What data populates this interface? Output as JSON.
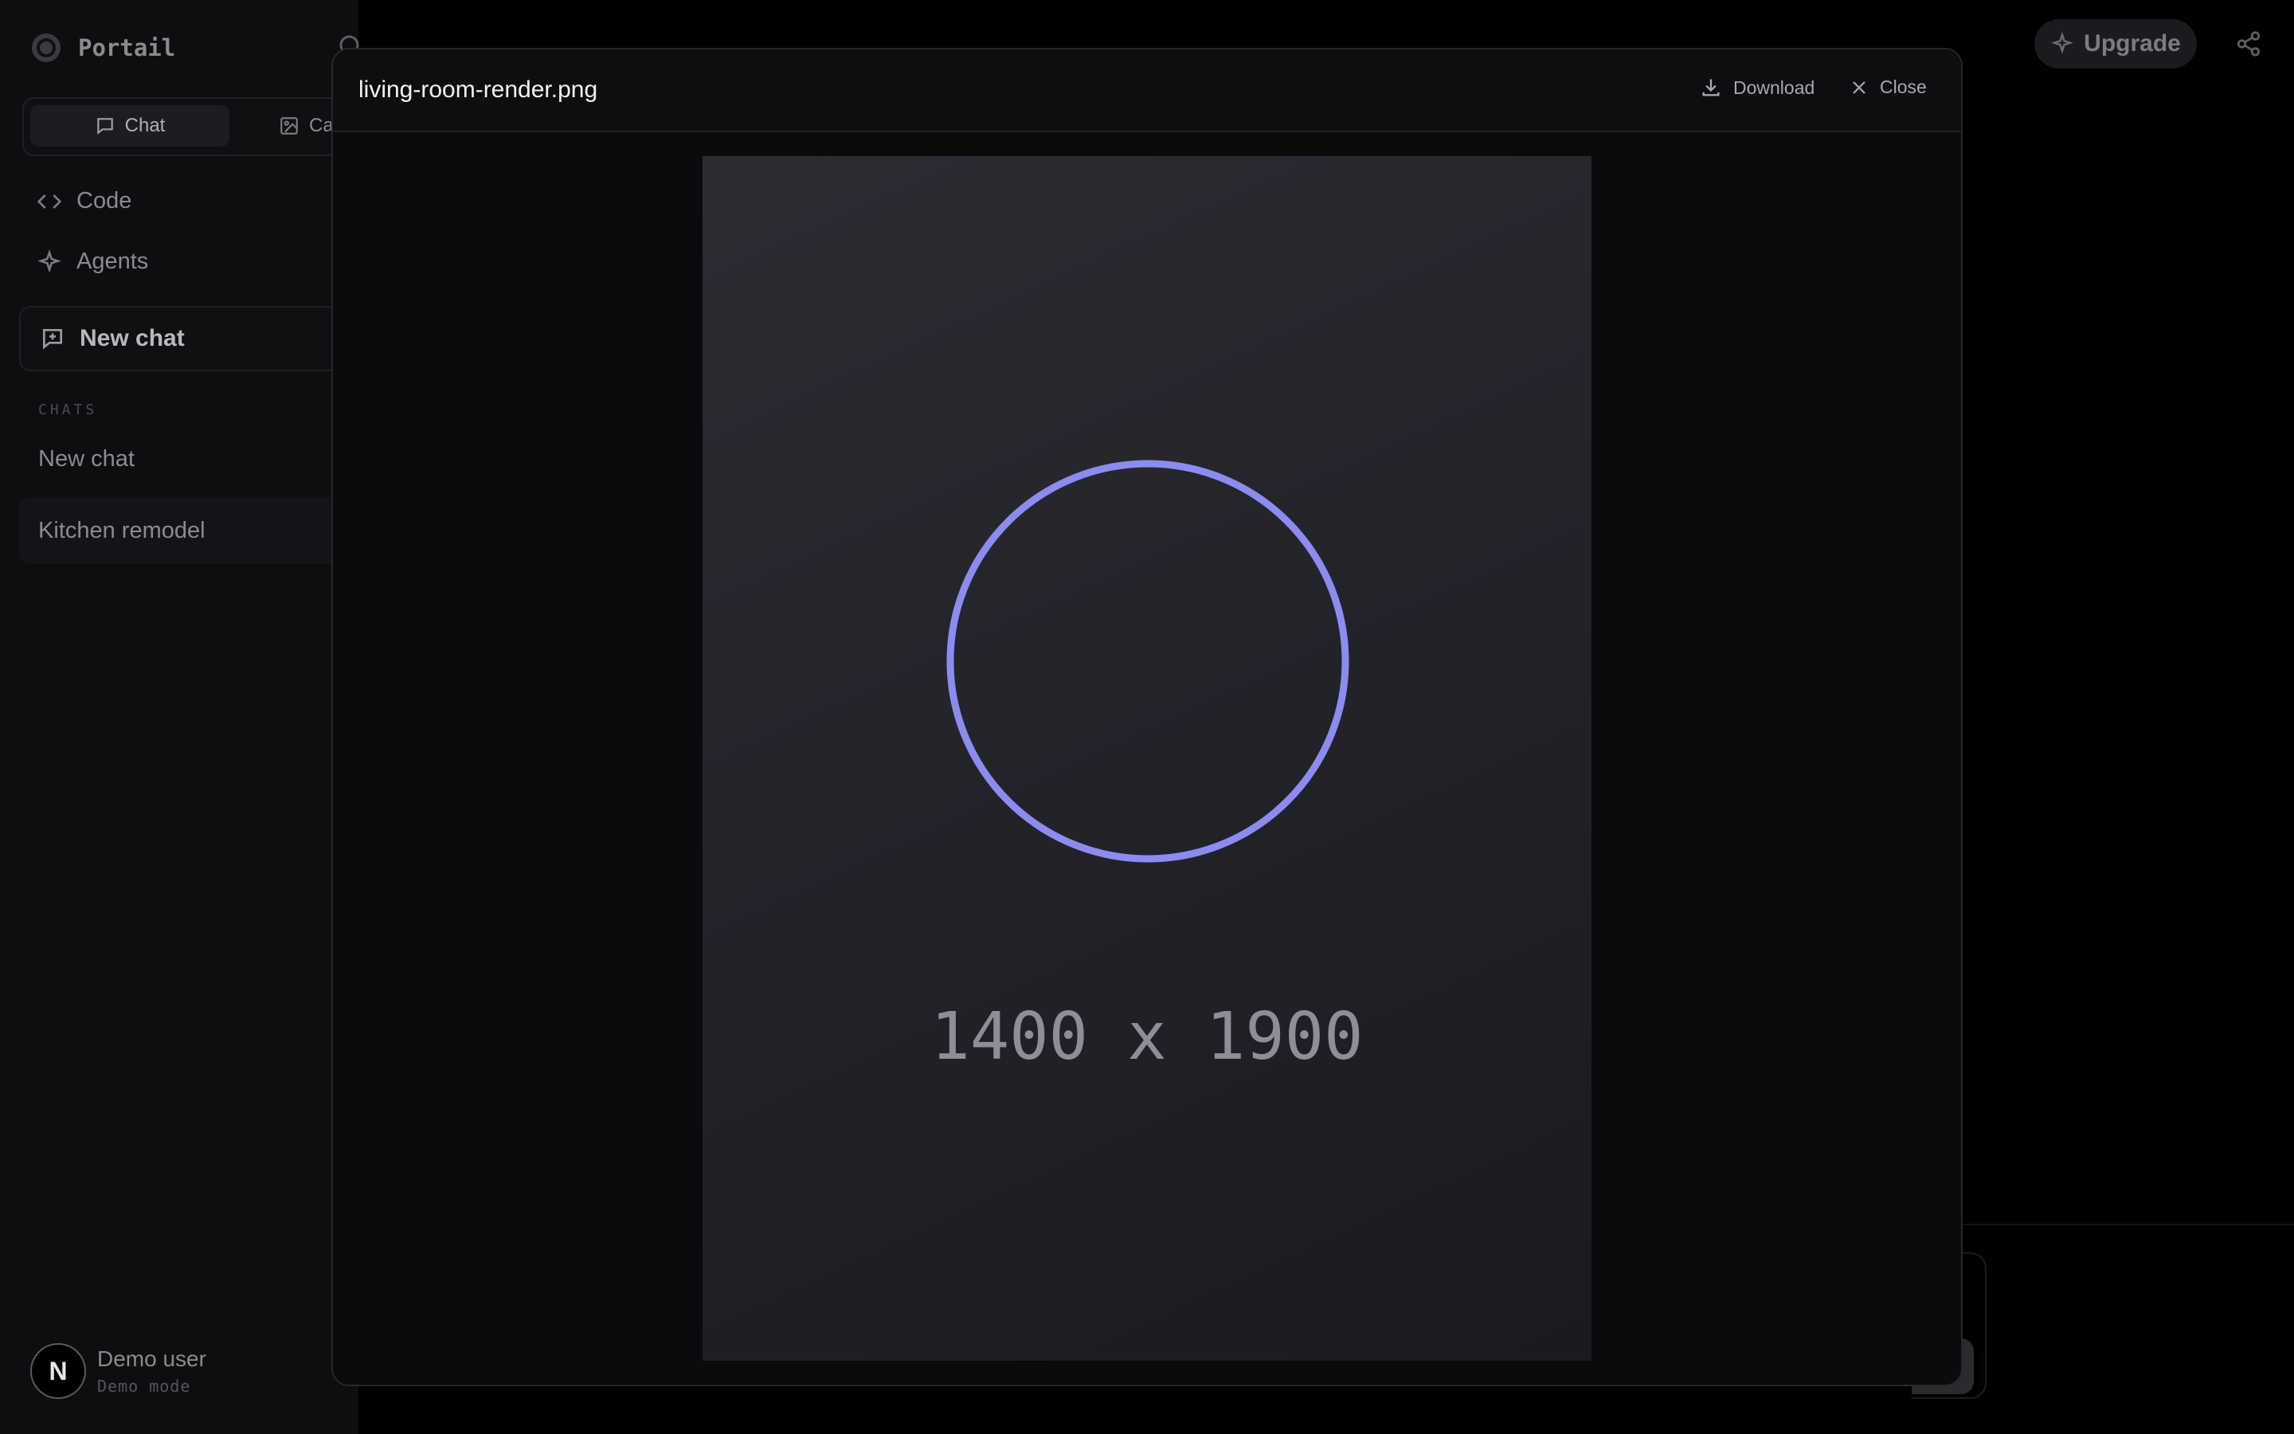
{
  "app": {
    "brand": "Portail",
    "tabs": [
      {
        "label": "Chat",
        "icon": "chat-bubble-icon",
        "active": true
      },
      {
        "label": "Ca",
        "icon": "image-icon",
        "active": false
      }
    ],
    "nav": [
      {
        "label": "Code",
        "icon": "code-icon"
      },
      {
        "label": "Agents",
        "icon": "sparkle-icon"
      }
    ],
    "new_chat_label": "New chat",
    "chats_section_label": "CHATS",
    "chats": [
      "New chat",
      "Kitchen remodel"
    ],
    "user": {
      "name": "Demo user",
      "mode": "Demo mode",
      "avatar_letter": "N"
    },
    "upgrade_label": "Upgrade"
  },
  "modal": {
    "title": "living-room-render.png",
    "download_label": "Download",
    "close_label": "Close",
    "placeholder_text": "1400 x 1900",
    "accent_color": "#8b8cf0"
  }
}
